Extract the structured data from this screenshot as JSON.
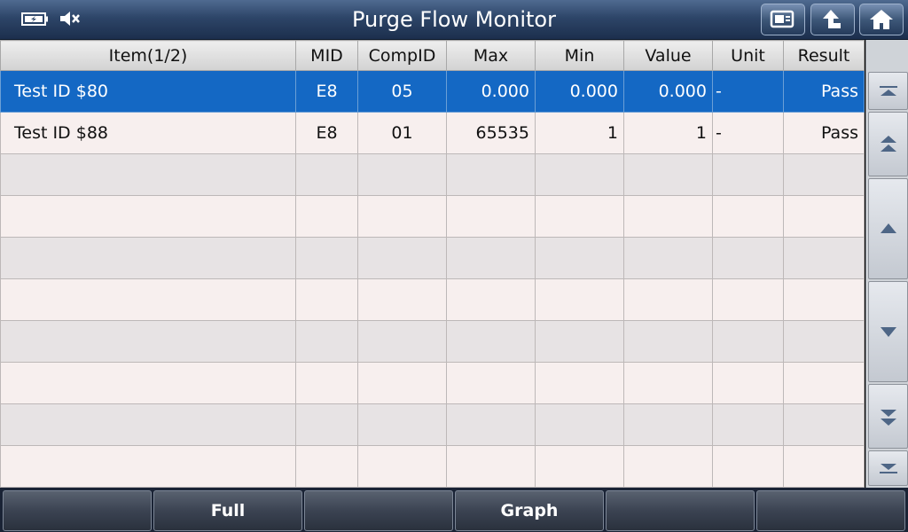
{
  "header": {
    "title": "Purge Flow Monitor",
    "status_icons": [
      "battery-charging-icon",
      "speaker-muted-icon"
    ],
    "buttons": [
      "print-screen-icon",
      "back-arrow-icon",
      "home-icon"
    ]
  },
  "table": {
    "columns": [
      "Item(1/2)",
      "MID",
      "CompID",
      "Max",
      "Min",
      "Value",
      "Unit",
      "Result"
    ],
    "rows": [
      [
        "Test ID $80",
        "E8",
        "05",
        "0.000",
        "0.000",
        "0.000",
        "-",
        "Pass"
      ],
      [
        "Test ID $88",
        "E8",
        "01",
        "65535",
        "1",
        "1",
        "-",
        "Pass"
      ],
      [
        "",
        "",
        "",
        "",
        "",
        "",
        "",
        ""
      ],
      [
        "",
        "",
        "",
        "",
        "",
        "",
        "",
        ""
      ],
      [
        "",
        "",
        "",
        "",
        "",
        "",
        "",
        ""
      ],
      [
        "",
        "",
        "",
        "",
        "",
        "",
        "",
        ""
      ],
      [
        "",
        "",
        "",
        "",
        "",
        "",
        "",
        ""
      ],
      [
        "",
        "",
        "",
        "",
        "",
        "",
        "",
        ""
      ],
      [
        "",
        "",
        "",
        "",
        "",
        "",
        "",
        ""
      ],
      [
        "",
        "",
        "",
        "",
        "",
        "",
        "",
        ""
      ]
    ],
    "selected_row": 0
  },
  "scroll": {
    "buttons": [
      "scroll-to-top-icon",
      "page-up-icon",
      "line-up-icon",
      "line-down-icon",
      "page-down-icon",
      "scroll-to-bottom-icon"
    ]
  },
  "footer": {
    "buttons": [
      "",
      "Full",
      "",
      "Graph",
      "",
      ""
    ]
  },
  "colors": {
    "selected_row": "#1468c4",
    "row_even": "#f7efee",
    "row_odd": "#e7e3e4",
    "title_bar": "#2d4568"
  }
}
